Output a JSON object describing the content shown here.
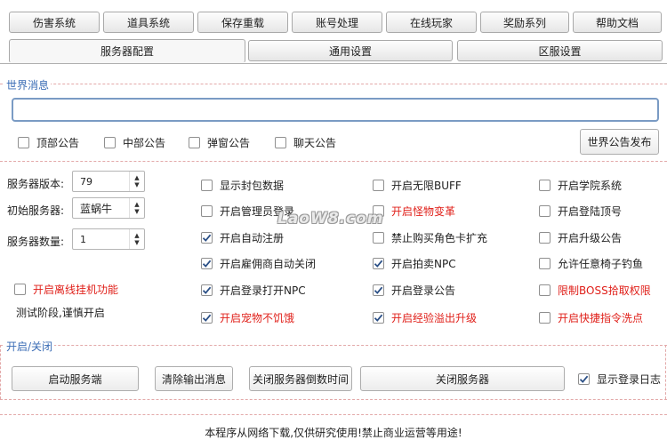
{
  "top_tabs": [
    "伤害系统",
    "道具系统",
    "保存重载",
    "账号处理",
    "在线玩家",
    "奖励系列",
    "帮助文档"
  ],
  "sub_tabs": [
    "服务器配置",
    "通用设置",
    "区服设置"
  ],
  "world_message": {
    "group_label": "世界消息",
    "input_value": "",
    "options": [
      {
        "label": "顶部公告",
        "checked": false
      },
      {
        "label": "中部公告",
        "checked": false
      },
      {
        "label": "弹窗公告",
        "checked": false
      },
      {
        "label": "聊天公告",
        "checked": false
      }
    ],
    "publish_button": "世界公告发布"
  },
  "server_fields": {
    "version_label": "服务器版本:",
    "version_value": "79",
    "initial_label": "初始服务器:",
    "initial_value": "蓝蜗牛",
    "count_label": "服务器数量:",
    "count_value": "1"
  },
  "offline_hangup": {
    "label": "开启离线挂机功能",
    "checked": false,
    "note": "测试阶段,谨慎开启"
  },
  "options_col1": [
    {
      "label": "显示封包数据",
      "checked": false,
      "red": false
    },
    {
      "label": "开启管理员登录",
      "checked": false,
      "red": false
    },
    {
      "label": "开启自动注册",
      "checked": true,
      "red": false
    },
    {
      "label": "开启雇佣商自动关闭",
      "checked": true,
      "red": false
    },
    {
      "label": "开启登录打开NPC",
      "checked": true,
      "red": false
    },
    {
      "label": "开启宠物不饥饿",
      "checked": true,
      "red": true
    }
  ],
  "options_col2": [
    {
      "label": "开启无限BUFF",
      "checked": false,
      "red": false
    },
    {
      "label": "开启怪物变革",
      "checked": false,
      "red": true
    },
    {
      "label": "禁止购买角色卡扩充",
      "checked": false,
      "red": false
    },
    {
      "label": "开启拍卖NPC",
      "checked": true,
      "red": false
    },
    {
      "label": "开启登录公告",
      "checked": true,
      "red": false
    },
    {
      "label": "开启经验溢出升级",
      "checked": true,
      "red": true
    }
  ],
  "options_col3": [
    {
      "label": "开启学院系统",
      "checked": false,
      "red": false
    },
    {
      "label": "开启登陆顶号",
      "checked": false,
      "red": false
    },
    {
      "label": "开启升级公告",
      "checked": false,
      "red": false
    },
    {
      "label": "允许任意椅子钓鱼",
      "checked": false,
      "red": false
    },
    {
      "label": "限制BOSS拾取权限",
      "checked": false,
      "red": true
    },
    {
      "label": "开启快捷指令洗点",
      "checked": false,
      "red": true
    }
  ],
  "power": {
    "group_label": "开启/关闭",
    "start_button": "启动服务端",
    "clear_button": "清除输出消息",
    "countdown_button": "关闭服务器倒数时间",
    "stop_button": "关闭服务器",
    "show_log": {
      "label": "显示登录日志",
      "checked": true
    }
  },
  "watermark": "LaoW8.com",
  "footer": "本程序从网络下载,仅供研究使用!禁止商业运营等用途!"
}
